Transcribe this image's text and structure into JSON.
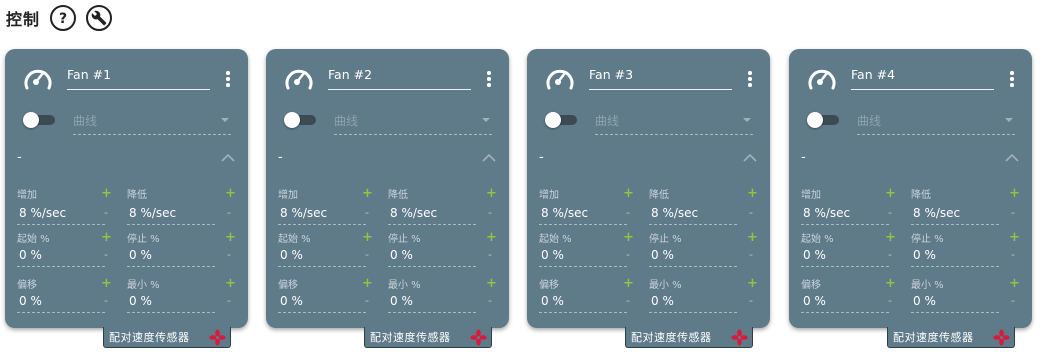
{
  "header": {
    "title": "控制",
    "help_icon": "help-circle-icon",
    "settings_icon": "wrench-icon"
  },
  "colors": {
    "card_bg": "#5f7a89",
    "add_green": "#8dc63f",
    "pair_icon_red": "#d81b3c"
  },
  "common": {
    "curve_placeholder": "曲线",
    "section_dash": "-",
    "labels": {
      "increase": "增加",
      "decrease": "降低",
      "start": "起始 %",
      "stop": "停止 %",
      "offset": "偏移",
      "min": "最小 %"
    },
    "plus": "+",
    "minus": "-",
    "pair_label": "配对速度传感器"
  },
  "cards": [
    {
      "name": "Fan #1",
      "increase": "8 %/sec",
      "decrease": "8 %/sec",
      "start": "0 %",
      "stop": "0 %",
      "offset": "0 %",
      "min": "0 %"
    },
    {
      "name": "Fan #2",
      "increase": "8 %/sec",
      "decrease": "8 %/sec",
      "start": "0 %",
      "stop": "0 %",
      "offset": "0 %",
      "min": "0 %"
    },
    {
      "name": "Fan #3",
      "increase": "8 %/sec",
      "decrease": "8 %/sec",
      "start": "0 %",
      "stop": "0 %",
      "offset": "0 %",
      "min": "0 %"
    },
    {
      "name": "Fan #4",
      "increase": "8 %/sec",
      "decrease": "8 %/sec",
      "start": "0 %",
      "stop": "0 %",
      "offset": "0 %",
      "min": "0 %"
    }
  ]
}
